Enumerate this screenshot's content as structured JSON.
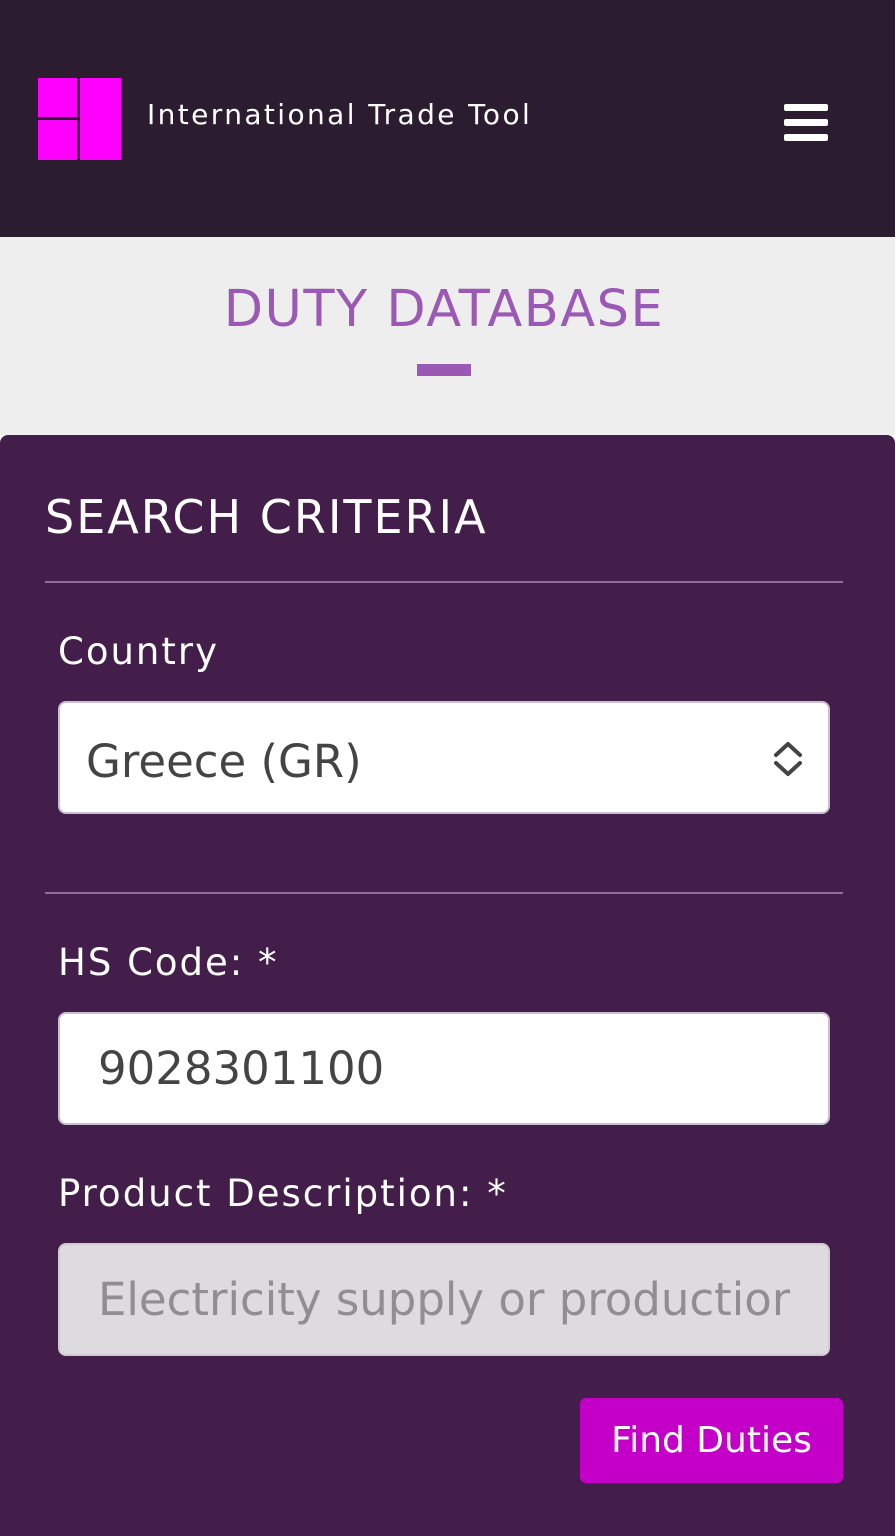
{
  "header": {
    "logo_icon": "grid-blocks-logo",
    "brand_text": "International Trade Tool",
    "menu_icon": "hamburger-menu-icon",
    "background_color": "#2b1c30",
    "logo_color": "#ff00ff"
  },
  "title_band": {
    "title": "DUTY DATABASE",
    "accent_color": "#9b59b6"
  },
  "search_panel": {
    "title": "SEARCH CRITERIA",
    "background_color": "#431e4a",
    "country": {
      "label": "Country",
      "selected_value": "Greece (GR)",
      "icon": "chevron-up-down-icon"
    },
    "hs_code": {
      "label": "HS Code: *",
      "value": "9028301100"
    },
    "product_description": {
      "label": "Product Description: *",
      "value": "Electricity supply or production meters"
    },
    "submit_button": {
      "label": "Find Duties",
      "color": "#c400c8"
    }
  }
}
